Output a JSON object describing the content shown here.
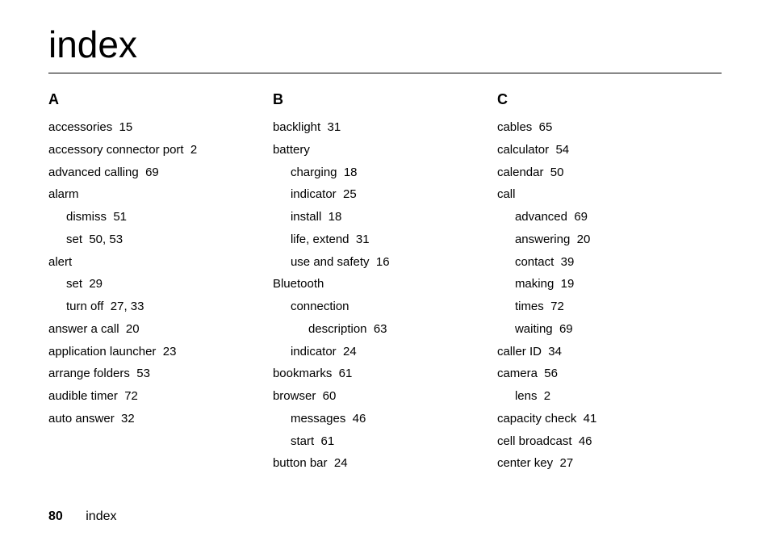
{
  "title": "index",
  "footer": {
    "page_number": "80",
    "section": "index"
  },
  "columns": [
    {
      "letter": "A",
      "entries": [
        {
          "text": "accessories  15",
          "level": 0
        },
        {
          "text": "accessory connector port  2",
          "level": 0
        },
        {
          "text": "advanced calling  69",
          "level": 0
        },
        {
          "text": "alarm",
          "level": 0
        },
        {
          "text": "dismiss  51",
          "level": 1
        },
        {
          "text": "set  50, 53",
          "level": 1
        },
        {
          "text": "alert",
          "level": 0
        },
        {
          "text": "set  29",
          "level": 1
        },
        {
          "text": "turn off  27, 33",
          "level": 1
        },
        {
          "text": "answer a call  20",
          "level": 0
        },
        {
          "text": "application launcher  23",
          "level": 0
        },
        {
          "text": "arrange folders  53",
          "level": 0
        },
        {
          "text": "audible timer  72",
          "level": 0
        },
        {
          "text": "auto answer  32",
          "level": 0
        }
      ]
    },
    {
      "letter": "B",
      "entries": [
        {
          "text": "backlight  31",
          "level": 0
        },
        {
          "text": "battery",
          "level": 0
        },
        {
          "text": "charging  18",
          "level": 1
        },
        {
          "text": "indicator  25",
          "level": 1
        },
        {
          "text": "install  18",
          "level": 1
        },
        {
          "text": "life, extend  31",
          "level": 1
        },
        {
          "text": "use and safety  16",
          "level": 1
        },
        {
          "text": "Bluetooth",
          "level": 0
        },
        {
          "text": "connection",
          "level": 1
        },
        {
          "text": "description  63",
          "level": 2
        },
        {
          "text": "indicator  24",
          "level": 1
        },
        {
          "text": "bookmarks  61",
          "level": 0
        },
        {
          "text": "browser  60",
          "level": 0
        },
        {
          "text": "messages  46",
          "level": 1
        },
        {
          "text": "start  61",
          "level": 1
        },
        {
          "text": "button bar  24",
          "level": 0
        }
      ]
    },
    {
      "letter": "C",
      "entries": [
        {
          "text": "cables  65",
          "level": 0
        },
        {
          "text": "calculator  54",
          "level": 0
        },
        {
          "text": "calendar  50",
          "level": 0
        },
        {
          "text": "call",
          "level": 0
        },
        {
          "text": "advanced  69",
          "level": 1
        },
        {
          "text": "answering  20",
          "level": 1
        },
        {
          "text": "contact  39",
          "level": 1
        },
        {
          "text": "making  19",
          "level": 1
        },
        {
          "text": "times  72",
          "level": 1
        },
        {
          "text": "waiting  69",
          "level": 1
        },
        {
          "text": "caller ID  34",
          "level": 0
        },
        {
          "text": "camera  56",
          "level": 0
        },
        {
          "text": "lens  2",
          "level": 1
        },
        {
          "text": "capacity check  41",
          "level": 0
        },
        {
          "text": "cell broadcast  46",
          "level": 0
        },
        {
          "text": "center key  27",
          "level": 0
        }
      ]
    }
  ]
}
